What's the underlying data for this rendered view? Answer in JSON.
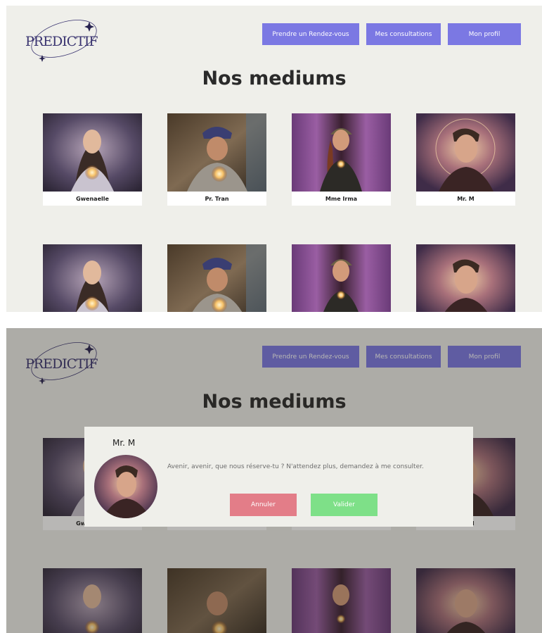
{
  "app": {
    "logo_text": "PREDICTIF"
  },
  "nav": {
    "appointment": "Prendre un Rendez-vous",
    "consultations": "Mes consultations",
    "profile": "Mon profil"
  },
  "page_title": "Nos mediums",
  "mediums": [
    {
      "name": "Gwenaelle",
      "portrait": "fortune-teller-woman-crystal-ball"
    },
    {
      "name": "Pr. Tran",
      "portrait": "old-man-turban-crystal-ball"
    },
    {
      "name": "Mme Irma",
      "portrait": "woman-headdress-purple-room"
    },
    {
      "name": "Mr. M",
      "portrait": "young-man-golden-halo"
    }
  ],
  "modal": {
    "medium_name": "Mr. M",
    "message": "Avenir, avenir, que nous réserve-tu ? N'attendez plus, demandez à me consulter.",
    "cancel": "Annuler",
    "confirm": "Valider"
  },
  "colors": {
    "background": "#efefea",
    "nav_button": "#7b78e3",
    "cancel": "#e37d88",
    "confirm": "#7ee088",
    "logo": "#3a3470"
  }
}
